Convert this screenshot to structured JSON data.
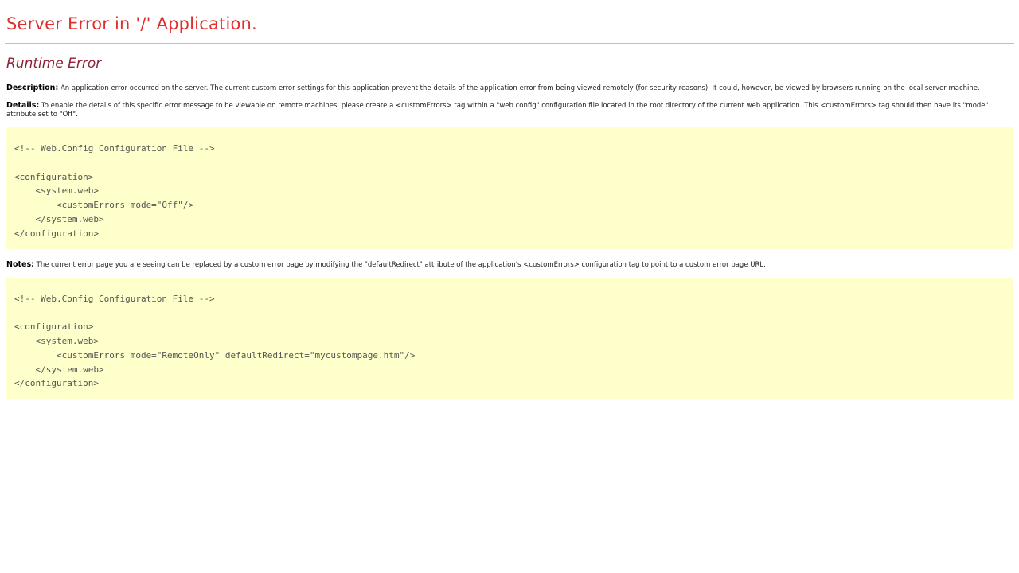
{
  "page": {
    "title": "Server Error in '/' Application.",
    "error_heading": "Runtime Error"
  },
  "description": {
    "label": "Description:",
    "text": " An application error occurred on the server. The current custom error settings for this application prevent the details of the application error from being viewed remotely (for security reasons). It could, however, be viewed by browsers running on the local server machine."
  },
  "details": {
    "label": "Details:",
    "text": " To enable the details of this specific error message to be viewable on remote machines, please create a <customErrors> tag within a \"web.config\" configuration file located in the root directory of the current web application. This <customErrors> tag should then have its \"mode\" attribute set to \"Off\"."
  },
  "code_block_1": {
    "lines": [
      "<!-- Web.Config Configuration File -->",
      "",
      "<configuration>",
      "    <system.web>",
      "        <customErrors mode=\"Off\"/>",
      "    </system.web>",
      "</configuration>"
    ]
  },
  "notes": {
    "label": "Notes:",
    "text": " The current error page you are seeing can be replaced by a custom error page by modifying the \"defaultRedirect\" attribute of the application's <customErrors> configuration tag to point to a custom error page URL."
  },
  "code_block_2": {
    "lines": [
      "<!-- Web.Config Configuration File -->",
      "",
      "<configuration>",
      "    <system.web>",
      "        <customErrors mode=\"RemoteOnly\" defaultRedirect=\"mycustompage.htm\"/>",
      "    </system.web>",
      "</configuration>"
    ]
  },
  "colors": {
    "title": "#e0302e",
    "heading": "#8e2236",
    "code_background": "#ffffcc"
  }
}
